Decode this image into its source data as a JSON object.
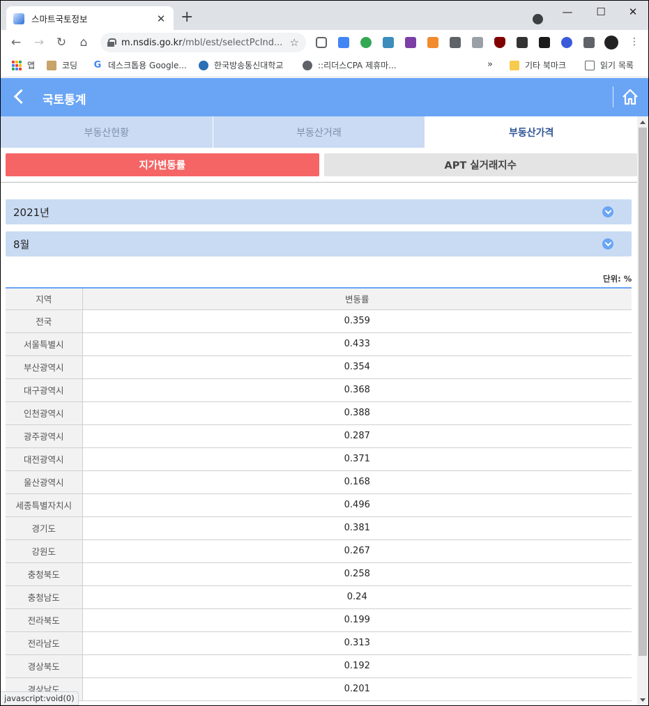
{
  "browser": {
    "tab_title": "스마트국토정보",
    "tab_close": "✕",
    "new_tab": "+",
    "window_controls": {
      "minimize": "—",
      "maximize": "☐",
      "close": "✕"
    },
    "url_host": "m.nsdis.go.kr",
    "url_path": "/mbl/est/selectPcInd...",
    "bookmarks": [
      {
        "label": "앱",
        "icon": "apps-grid-icon"
      },
      {
        "label": "코딩",
        "icon": "dog-icon"
      },
      {
        "label": "데스크톱용 Google...",
        "icon": "google-icon"
      },
      {
        "label": "한국방송통신대학교",
        "icon": "knou-icon"
      },
      {
        "label": "::리더스CPA 제휴마...",
        "icon": "globe-icon"
      }
    ],
    "bookmarks_overflow": "»",
    "other_bookmarks": "기타 북마크",
    "reading_list": "읽기 목록",
    "status_text": "javascript:void(0)"
  },
  "appbar": {
    "title": "국토통계"
  },
  "main_tabs": [
    {
      "label": "부동산현황",
      "active": false
    },
    {
      "label": "부동산거래",
      "active": false
    },
    {
      "label": "부동산가격",
      "active": true
    }
  ],
  "sub_tabs": [
    {
      "label": "지가변동률",
      "active": true
    },
    {
      "label": "APT 실거래지수",
      "active": false
    }
  ],
  "filters": {
    "year": "2021년",
    "month": "8월"
  },
  "unit_label": "단위: %",
  "table": {
    "headers": [
      "지역",
      "변동률"
    ],
    "rows": [
      {
        "region": "전국",
        "value": "0.359"
      },
      {
        "region": "서울특별시",
        "value": "0.433"
      },
      {
        "region": "부산광역시",
        "value": "0.354"
      },
      {
        "region": "대구광역시",
        "value": "0.368"
      },
      {
        "region": "인천광역시",
        "value": "0.388"
      },
      {
        "region": "광주광역시",
        "value": "0.287"
      },
      {
        "region": "대전광역시",
        "value": "0.371"
      },
      {
        "region": "울산광역시",
        "value": "0.168"
      },
      {
        "region": "세종특별자치시",
        "value": "0.496"
      },
      {
        "region": "경기도",
        "value": "0.381"
      },
      {
        "region": "강원도",
        "value": "0.267"
      },
      {
        "region": "충청북도",
        "value": "0.258"
      },
      {
        "region": "충청남도",
        "value": "0.24"
      },
      {
        "region": "전라북도",
        "value": "0.199"
      },
      {
        "region": "전라남도",
        "value": "0.313"
      },
      {
        "region": "경상북도",
        "value": "0.192"
      },
      {
        "region": "경상남도",
        "value": "0.201"
      }
    ]
  },
  "colors": {
    "appbar": "#6aa5f5",
    "active_subtab": "#f56565",
    "inactive_maintab": "#cadbf3",
    "select_bar": "#c9dbf3",
    "active_maintab_text": "#2f5597"
  }
}
